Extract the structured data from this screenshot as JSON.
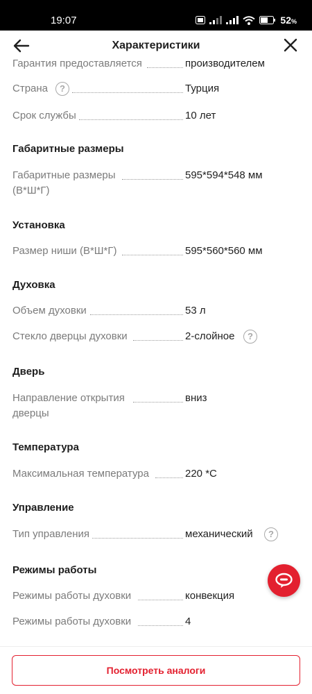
{
  "status_bar": {
    "time": "19:07",
    "battery": "52",
    "battery_unit": "%"
  },
  "header": {
    "title": "Характеристики"
  },
  "specs": {
    "warranty": {
      "label": "Гарантия предоставляется",
      "value": "производителем"
    },
    "country": {
      "label": "Страна",
      "value": "Турция"
    },
    "service_life": {
      "label": "Срок службы",
      "value": "10 лет"
    },
    "dimensions_section": {
      "title": "Габаритные размеры"
    },
    "dimensions": {
      "label_line1": "Габаритные размеры",
      "label_line2": "(В*Ш*Г)",
      "value": "595*594*548 мм"
    },
    "installation_section": {
      "title": "Установка"
    },
    "niche_size": {
      "label": "Размер ниши (В*Ш*Г)",
      "value": "595*560*560 мм"
    },
    "oven_section": {
      "title": "Духовка"
    },
    "oven_volume": {
      "label": "Объем духовки",
      "value": "53 л"
    },
    "oven_glass": {
      "label": "Стекло дверцы духовки",
      "value": "2-слойное"
    },
    "door_section": {
      "title": "Дверь"
    },
    "door_opening": {
      "label_line1": "Направление открытия",
      "label_line2": "дверцы",
      "value": "вниз"
    },
    "temperature_section": {
      "title": "Температура"
    },
    "max_temp": {
      "label": "Максимальная температура",
      "value": "220 *С"
    },
    "control_section": {
      "title": "Управление"
    },
    "control_type": {
      "label": "Тип управления",
      "value": "механический"
    },
    "modes_section": {
      "title": "Режимы работы"
    },
    "oven_modes": {
      "label": "Режимы работы духовки",
      "value": "конвекция"
    },
    "oven_modes_count": {
      "label": "Режимы работы духовки",
      "value": "4"
    }
  },
  "help_icon_glyph": "?",
  "bottom": {
    "analogs_button": "Посмотреть аналоги"
  },
  "colors": {
    "accent": "#e3202f",
    "label": "#7b7b7b",
    "text": "#1f1f1f"
  },
  "icons": [
    "back-arrow-icon",
    "close-icon",
    "help-icon",
    "chat-icon",
    "wifi-icon",
    "signal-icon",
    "battery-icon"
  ]
}
